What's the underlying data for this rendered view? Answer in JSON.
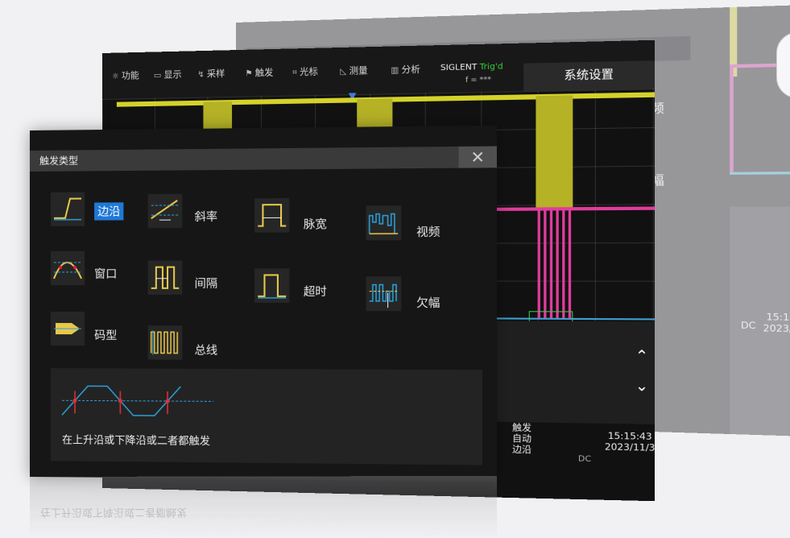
{
  "back_screen": {
    "dialog_title": "触发类型",
    "close_glyph": "✕",
    "labels": [
      "视频",
      "欠幅"
    ],
    "status": {
      "dc": "DC",
      "time": "15:15:43",
      "date": "2023/11/3"
    },
    "chevron_up": "⌃",
    "chevron_down": "⌄"
  },
  "mid_screen": {
    "menu": [
      {
        "icon": "☼",
        "label": "功能"
      },
      {
        "icon": "▭",
        "label": "显示"
      },
      {
        "icon": "↯",
        "label": "采样"
      },
      {
        "icon": "⚑",
        "label": "触发"
      },
      {
        "icon": "⌗",
        "label": "光标"
      },
      {
        "icon": "◺",
        "label": "测量"
      },
      {
        "icon": "▥",
        "label": "分析"
      }
    ],
    "brand": "SIGLENT",
    "trigger_state": "Trig'd",
    "brand_sub": "f = ***",
    "system_settings": "系统设置",
    "trigger_status": [
      "触发",
      "自动",
      "边沿"
    ],
    "dc": "DC",
    "time": "15:15:43",
    "date": "2023/11/3",
    "chevron_up": "⌃",
    "chevron_down": "⌄",
    "colors": {
      "ch1": "#d4d22a",
      "ch2": "#e13c9c",
      "ch3": "#3f9fd3"
    }
  },
  "front_dialog": {
    "title": "触发类型",
    "close_glyph": "✕",
    "types": [
      {
        "id": "edge",
        "label": "边沿",
        "selected": true
      },
      {
        "id": "slope",
        "label": "斜率"
      },
      {
        "id": "pulse",
        "label": "脉宽"
      },
      {
        "id": "video",
        "label": "视频"
      },
      {
        "id": "window",
        "label": "窗口"
      },
      {
        "id": "interval",
        "label": "间隔"
      },
      {
        "id": "timeout",
        "label": "超时"
      },
      {
        "id": "runt",
        "label": "欠幅"
      },
      {
        "id": "pattern",
        "label": "码型"
      },
      {
        "id": "bus",
        "label": "总线"
      }
    ],
    "description": "在上升沿或下降沿或二者都触发"
  }
}
